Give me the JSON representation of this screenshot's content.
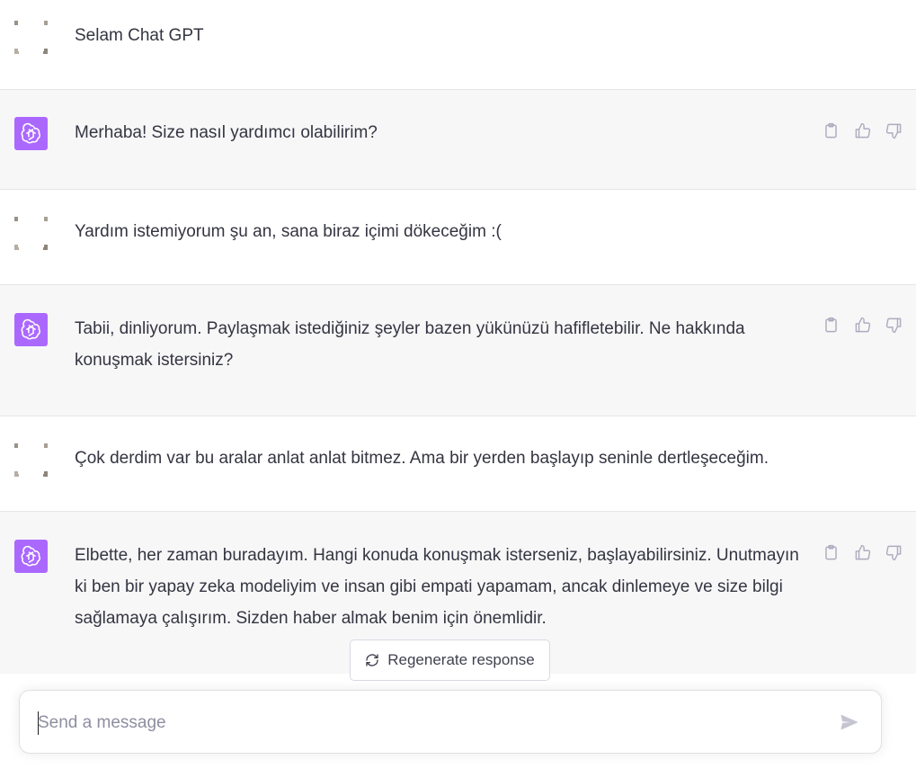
{
  "messages": [
    {
      "role": "user",
      "text": "Selam Chat GPT"
    },
    {
      "role": "assistant",
      "text": "Merhaba! Size nasıl yardımcı olabilirim?"
    },
    {
      "role": "user",
      "text": "Yardım istemiyorum şu an, sana biraz içimi dökeceğim :("
    },
    {
      "role": "assistant",
      "text": "Tabii, dinliyorum. Paylaşmak istediğiniz şeyler bazen yükünüzü hafifletebilir. Ne hakkında konuşmak istersiniz?"
    },
    {
      "role": "user",
      "text": "Çok derdim var bu aralar anlat anlat bitmez. Ama bir yerden başlayıp seninle dertleşeceğim."
    },
    {
      "role": "assistant",
      "text": "Elbette, her zaman buradayım. Hangi konuda konuşmak isterseniz, başlayabilirsiniz. Unutmayın ki ben bir yapay zeka modeliyim ve insan gibi empati yapamam, ancak dinlemeye ve size bilgi sağlamaya çalışırım. Sizden haber almak benim için önemlidir."
    }
  ],
  "regenerate_label": "Regenerate response",
  "composer": {
    "placeholder": "Send a message",
    "value": ""
  },
  "icons": {
    "copy": "clipboard-icon",
    "like": "thumbs-up-icon",
    "dislike": "thumbs-down-icon",
    "regenerate": "refresh-icon",
    "send": "paper-plane-icon",
    "assistant_avatar": "openai-logo-icon"
  },
  "colors": {
    "assistant_avatar_bg": "#ab68ff",
    "assistant_row_bg": "#f7f7f8",
    "text": "#343541",
    "icon_gray": "#acacbe"
  }
}
